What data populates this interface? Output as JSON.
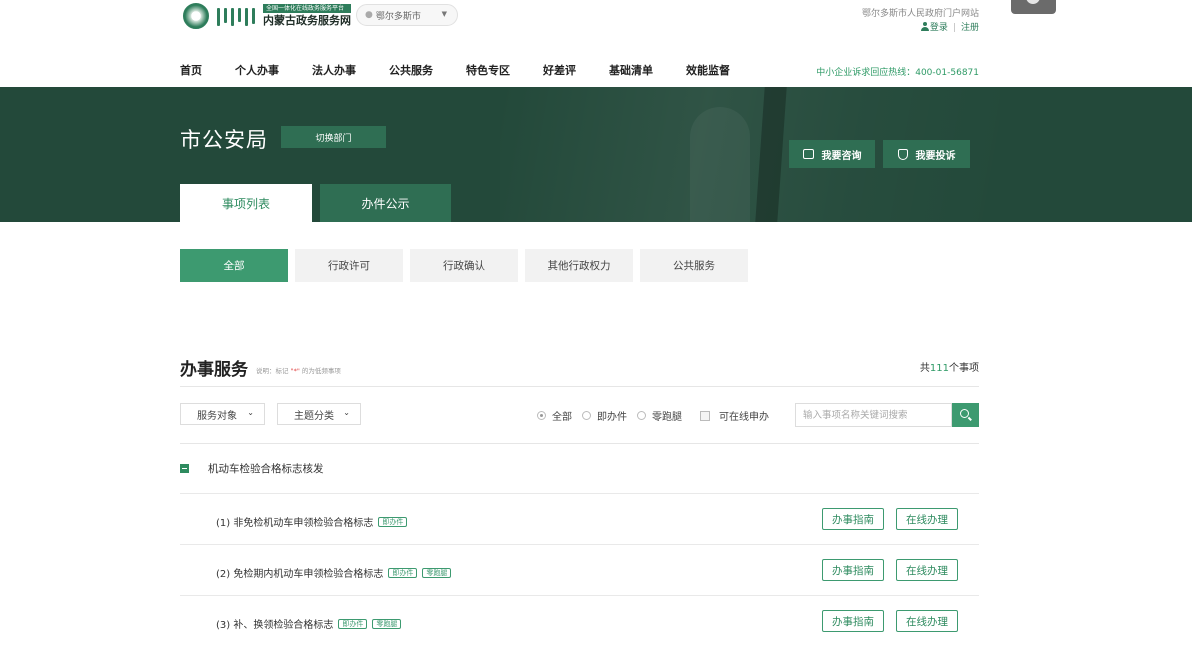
{
  "header": {
    "logo_subtitle": "全国一体化在线政务服务平台",
    "logo_title": "内蒙古政务服务网",
    "location": "鄂尔多斯市",
    "gov_link": "鄂尔多斯市人民政府门户网站",
    "login": "登录",
    "register": "注册",
    "hotline": "中小企业诉求回应热线：400-01-56871"
  },
  "nav": {
    "items": [
      "首页",
      "个人办事",
      "法人办事",
      "公共服务",
      "特色专区",
      "好差评",
      "基础清单",
      "效能监督"
    ]
  },
  "banner": {
    "dept_title": "市公安局",
    "switch_dept": "切换部门",
    "consult": "我要咨询",
    "complain": "我要投诉",
    "tabs": [
      "事项列表",
      "办件公示"
    ]
  },
  "categories": {
    "items": [
      "全部",
      "行政许可",
      "行政确认",
      "其他行政权力",
      "公共服务"
    ],
    "active_index": 0
  },
  "service": {
    "title": "办事服务",
    "note_prefix": "说明：标记",
    "note_mark": "\"*\"",
    "note_suffix": "的为低频事项",
    "count_prefix": "共",
    "count": "111",
    "count_suffix": "个事项",
    "filter_object": "服务对象",
    "filter_topic": "主题分类",
    "radios": [
      "全部",
      "即办件",
      "零跑腿"
    ],
    "checkbox_label": "可在线申办",
    "search_placeholder": "输入事项名称关键词搜索"
  },
  "group": {
    "title": "机动车检验合格标志核发",
    "items": [
      {
        "text": "(1) 非免检机动车申领检验合格标志",
        "tags": [
          "即办件"
        ]
      },
      {
        "text": "(2) 免检期内机动车申领检验合格标志",
        "tags": [
          "即办件",
          "零跑腿"
        ]
      },
      {
        "text": "(3) 补、换领检验合格标志",
        "tags": [
          "即办件",
          "零跑腿"
        ]
      }
    ],
    "guide_label": "办事指南",
    "online_label": "在线办理"
  },
  "colors": {
    "brand_green": "#3d9a70",
    "banner_dark": "#23493a",
    "accent_red": "#e04040"
  }
}
